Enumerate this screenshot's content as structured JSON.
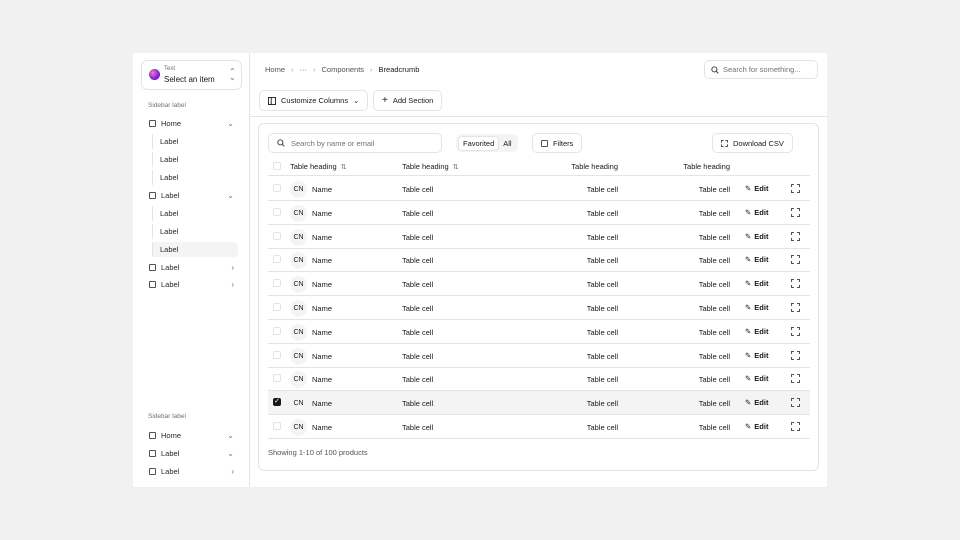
{
  "sidebar": {
    "switcher": {
      "small": "Text",
      "title": "Select an item"
    },
    "group1_label": "Sidebar label",
    "items": [
      {
        "label": "Home",
        "chev": "⌄",
        "children": [
          "Label",
          "Label",
          "Label"
        ]
      },
      {
        "label": "Label",
        "chev": "⌄",
        "children": [
          "Label",
          "Label",
          "Label"
        ]
      },
      {
        "label": "Label",
        "chev": "›"
      },
      {
        "label": "Label",
        "chev": "›"
      }
    ],
    "group2_label": "Sidebar label",
    "items2": [
      {
        "label": "Home",
        "chev": "⌄"
      },
      {
        "label": "Label",
        "chev": "⌄"
      },
      {
        "label": "Label",
        "chev": "›"
      }
    ]
  },
  "breadcrumb": [
    "Home",
    "···",
    "Components",
    "Breadcrumb"
  ],
  "top_search": {
    "placeholder": "Search for something..."
  },
  "toolbar": {
    "customize": "Customize Columns",
    "add_section": "Add Section"
  },
  "table_controls": {
    "search_placeholder": "Search by name or email",
    "segment": [
      "Favorited",
      "All"
    ],
    "filters": "Filters",
    "download": "Download CSV"
  },
  "table": {
    "headings": [
      "Table heading",
      "Table heading",
      "Table heading",
      "Table heading"
    ],
    "rows": [
      {
        "initials": "CN",
        "name": "Name",
        "c1": "Table cell",
        "c2": "Table cell",
        "c3": "Table cell",
        "edit": "Edit",
        "checked": false
      },
      {
        "initials": "CN",
        "name": "Name",
        "c1": "Table cell",
        "c2": "Table cell",
        "c3": "Table cell",
        "edit": "Edit",
        "checked": false
      },
      {
        "initials": "CN",
        "name": "Name",
        "c1": "Table cell",
        "c2": "Table cell",
        "c3": "Table cell",
        "edit": "Edit",
        "checked": false
      },
      {
        "initials": "CN",
        "name": "Name",
        "c1": "Table cell",
        "c2": "Table cell",
        "c3": "Table cell",
        "edit": "Edit",
        "checked": false
      },
      {
        "initials": "CN",
        "name": "Name",
        "c1": "Table cell",
        "c2": "Table cell",
        "c3": "Table cell",
        "edit": "Edit",
        "checked": false
      },
      {
        "initials": "CN",
        "name": "Name",
        "c1": "Table cell",
        "c2": "Table cell",
        "c3": "Table cell",
        "edit": "Edit",
        "checked": false
      },
      {
        "initials": "CN",
        "name": "Name",
        "c1": "Table cell",
        "c2": "Table cell",
        "c3": "Table cell",
        "edit": "Edit",
        "checked": false
      },
      {
        "initials": "CN",
        "name": "Name",
        "c1": "Table cell",
        "c2": "Table cell",
        "c3": "Table cell",
        "edit": "Edit",
        "checked": false
      },
      {
        "initials": "CN",
        "name": "Name",
        "c1": "Table cell",
        "c2": "Table cell",
        "c3": "Table cell",
        "edit": "Edit",
        "checked": false
      },
      {
        "initials": "CN",
        "name": "Name",
        "c1": "Table cell",
        "c2": "Table cell",
        "c3": "Table cell",
        "edit": "Edit",
        "checked": true
      },
      {
        "initials": "CN",
        "name": "Name",
        "c1": "Table cell",
        "c2": "Table cell",
        "c3": "Table cell",
        "edit": "Edit",
        "checked": false
      }
    ],
    "footer": "Showing 1-10 of 100 products"
  },
  "icons": {
    "search": "search-icon",
    "columns": "columns-icon",
    "plus": "plus-icon",
    "pencil": "pencil-icon",
    "sort": "sort-icon"
  }
}
